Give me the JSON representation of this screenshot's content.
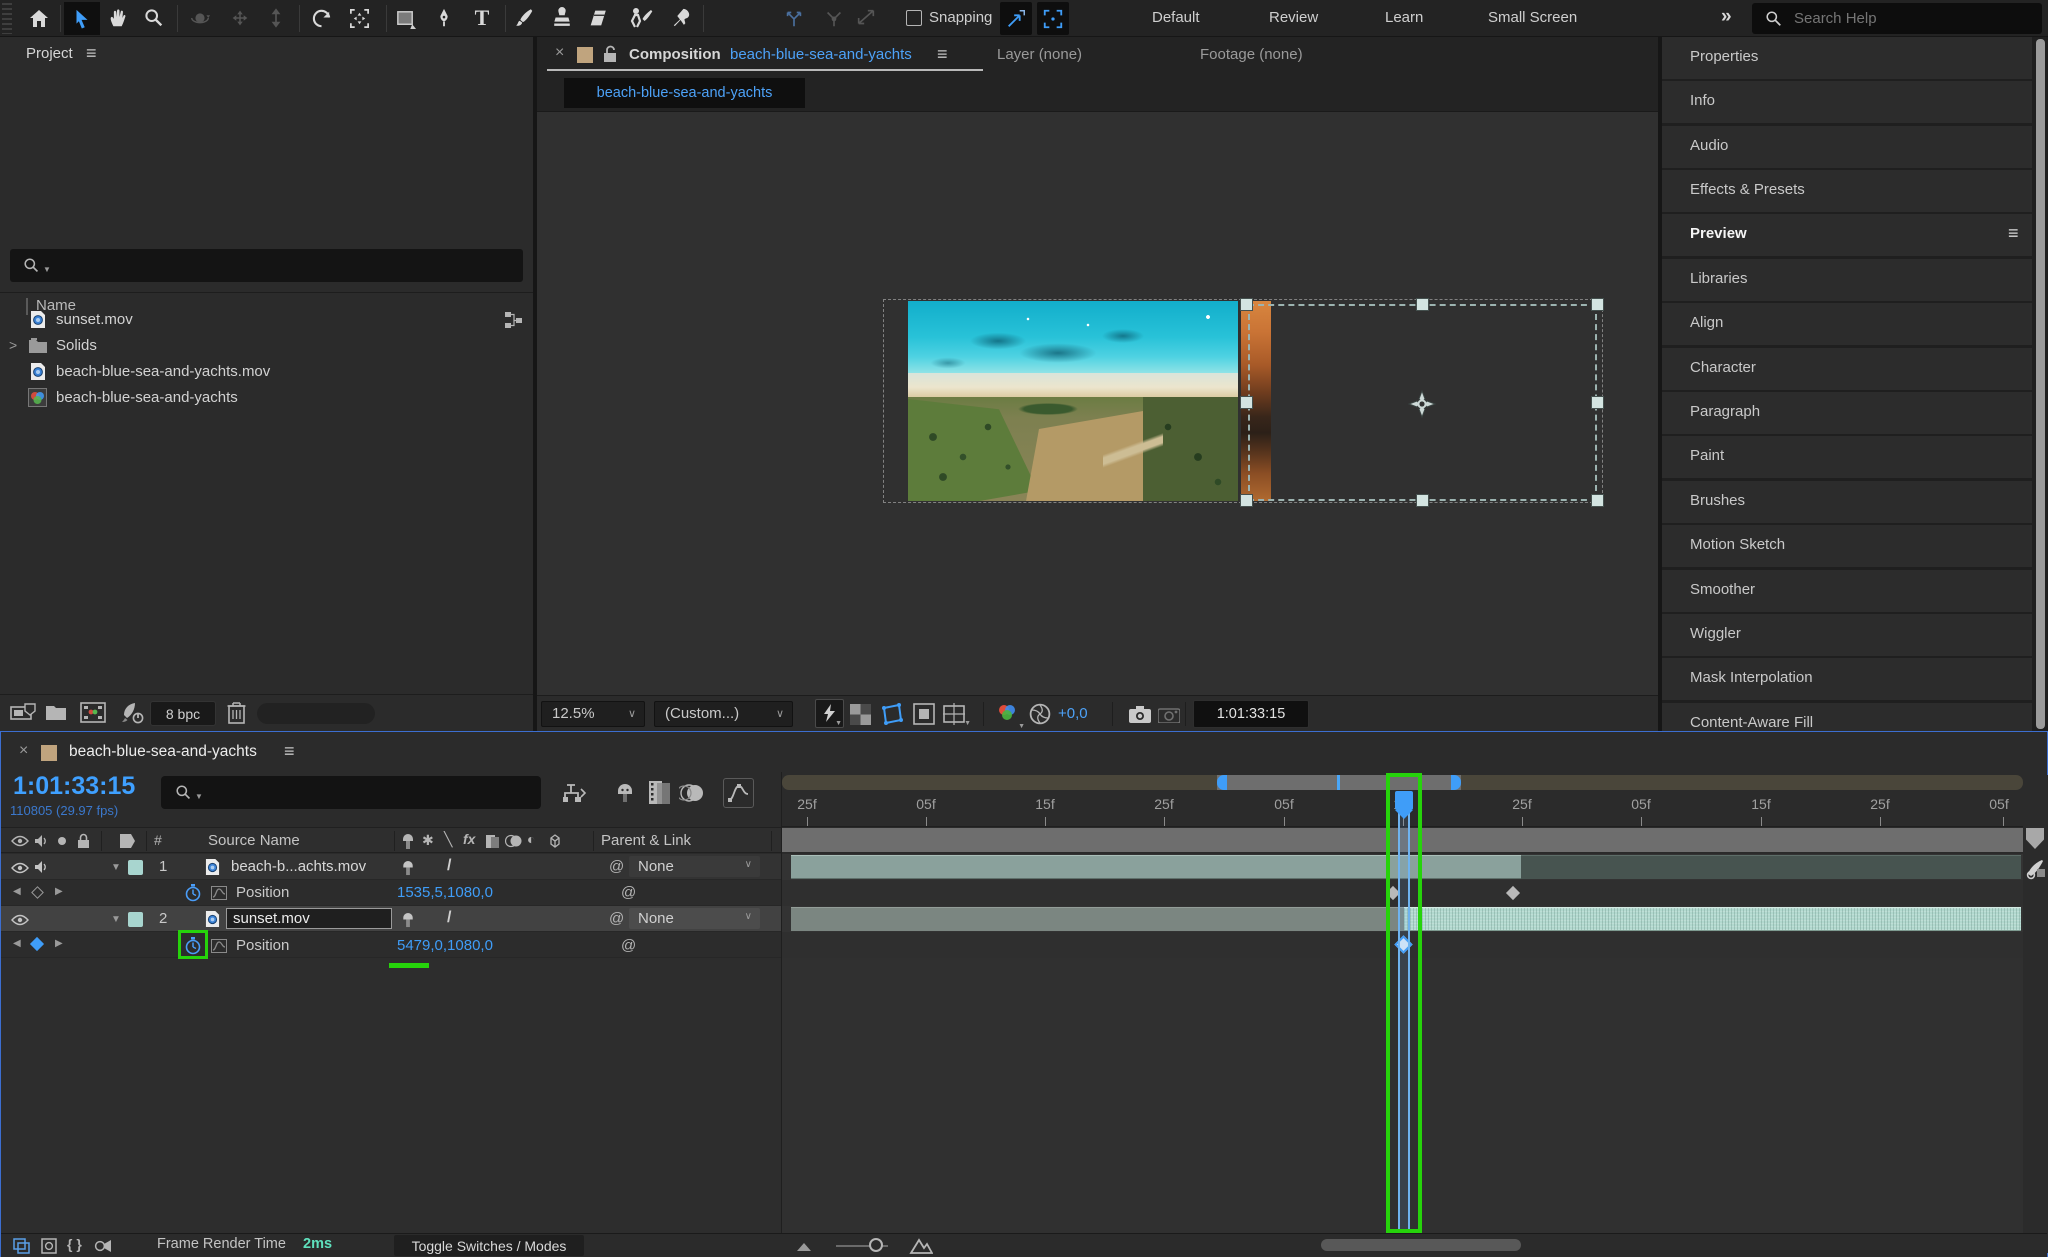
{
  "glyphs": {
    "close": "×",
    "menu": "≡",
    "overflow": "»",
    "chevron_down": "∨",
    "chevron_right": ">",
    "arrow_left": "◀",
    "arrow_right": "▶",
    "at": "@",
    "slash": "/",
    "asterisk": "✱",
    "half_circle": "◐",
    "backslash": "╲",
    "fx": "fx",
    "text_tool": "T",
    "braces": "{ }"
  },
  "colors": {
    "accent_blue": "#3f9df8",
    "annotation_green": "#26d30b",
    "label_teal": "#a8d5cf",
    "render_time_teal": "#5fe0bd",
    "tab_tan": "#c0a47e",
    "selected_bar_mint": "#b2d9cf"
  },
  "toolbar": {
    "snapping_label": "Snapping",
    "workspaces": [
      "Default",
      "Review",
      "Learn",
      "Small Screen"
    ],
    "search_placeholder": "Search Help"
  },
  "project": {
    "title": "Project",
    "name_column": "Name",
    "items": [
      {
        "label": "sunset.mov"
      },
      {
        "label": "Solids"
      },
      {
        "label": "beach-blue-sea-and-yachts.mov"
      },
      {
        "label": "beach-blue-sea-and-yachts"
      }
    ],
    "bit_depth": "8 bpc"
  },
  "viewer": {
    "tab_label": "Composition",
    "comp_name": "beach-blue-sea-and-yachts",
    "layer_tab": "Layer (none)",
    "footage_tab": "Footage (none)",
    "sub_tab": "beach-blue-sea-and-yachts",
    "zoom": "12.5%",
    "resolution": "(Custom...)",
    "exposure": "+0,0",
    "timecode": "1:01:33:15"
  },
  "sidebar": {
    "panels": [
      "Properties",
      "Info",
      "Audio",
      "Effects & Presets",
      "Preview",
      "Libraries",
      "Align",
      "Character",
      "Paragraph",
      "Paint",
      "Brushes",
      "Motion Sketch",
      "Smoother",
      "Wiggler",
      "Mask Interpolation",
      "Content-Aware Fill"
    ]
  },
  "timeline": {
    "comp_name": "beach-blue-sea-and-yachts",
    "timecode": "1:01:33:15",
    "frame_info": "110805 (29.97 fps)",
    "hash_column": "#",
    "source_name_column": "Source Name",
    "parent_link_column": "Parent & Link",
    "layers": [
      {
        "num": "1",
        "name": "beach-b...achts.mov",
        "parent": "None",
        "property": "Position",
        "value": "1535,5,1080,0"
      },
      {
        "num": "2",
        "name": "sunset.mov",
        "parent": "None",
        "property": "Position",
        "value": "5479,0,1080,0"
      }
    ],
    "ruler_labels": [
      "25f",
      "05f",
      "15f",
      "25f",
      "05f",
      "15f",
      "25f",
      "05f",
      "15f",
      "25f",
      "05f"
    ],
    "footer": {
      "frame_render_label": "Frame Render Time",
      "frame_render_value": "2ms",
      "toggle_label": "Toggle Switches / Modes"
    }
  }
}
